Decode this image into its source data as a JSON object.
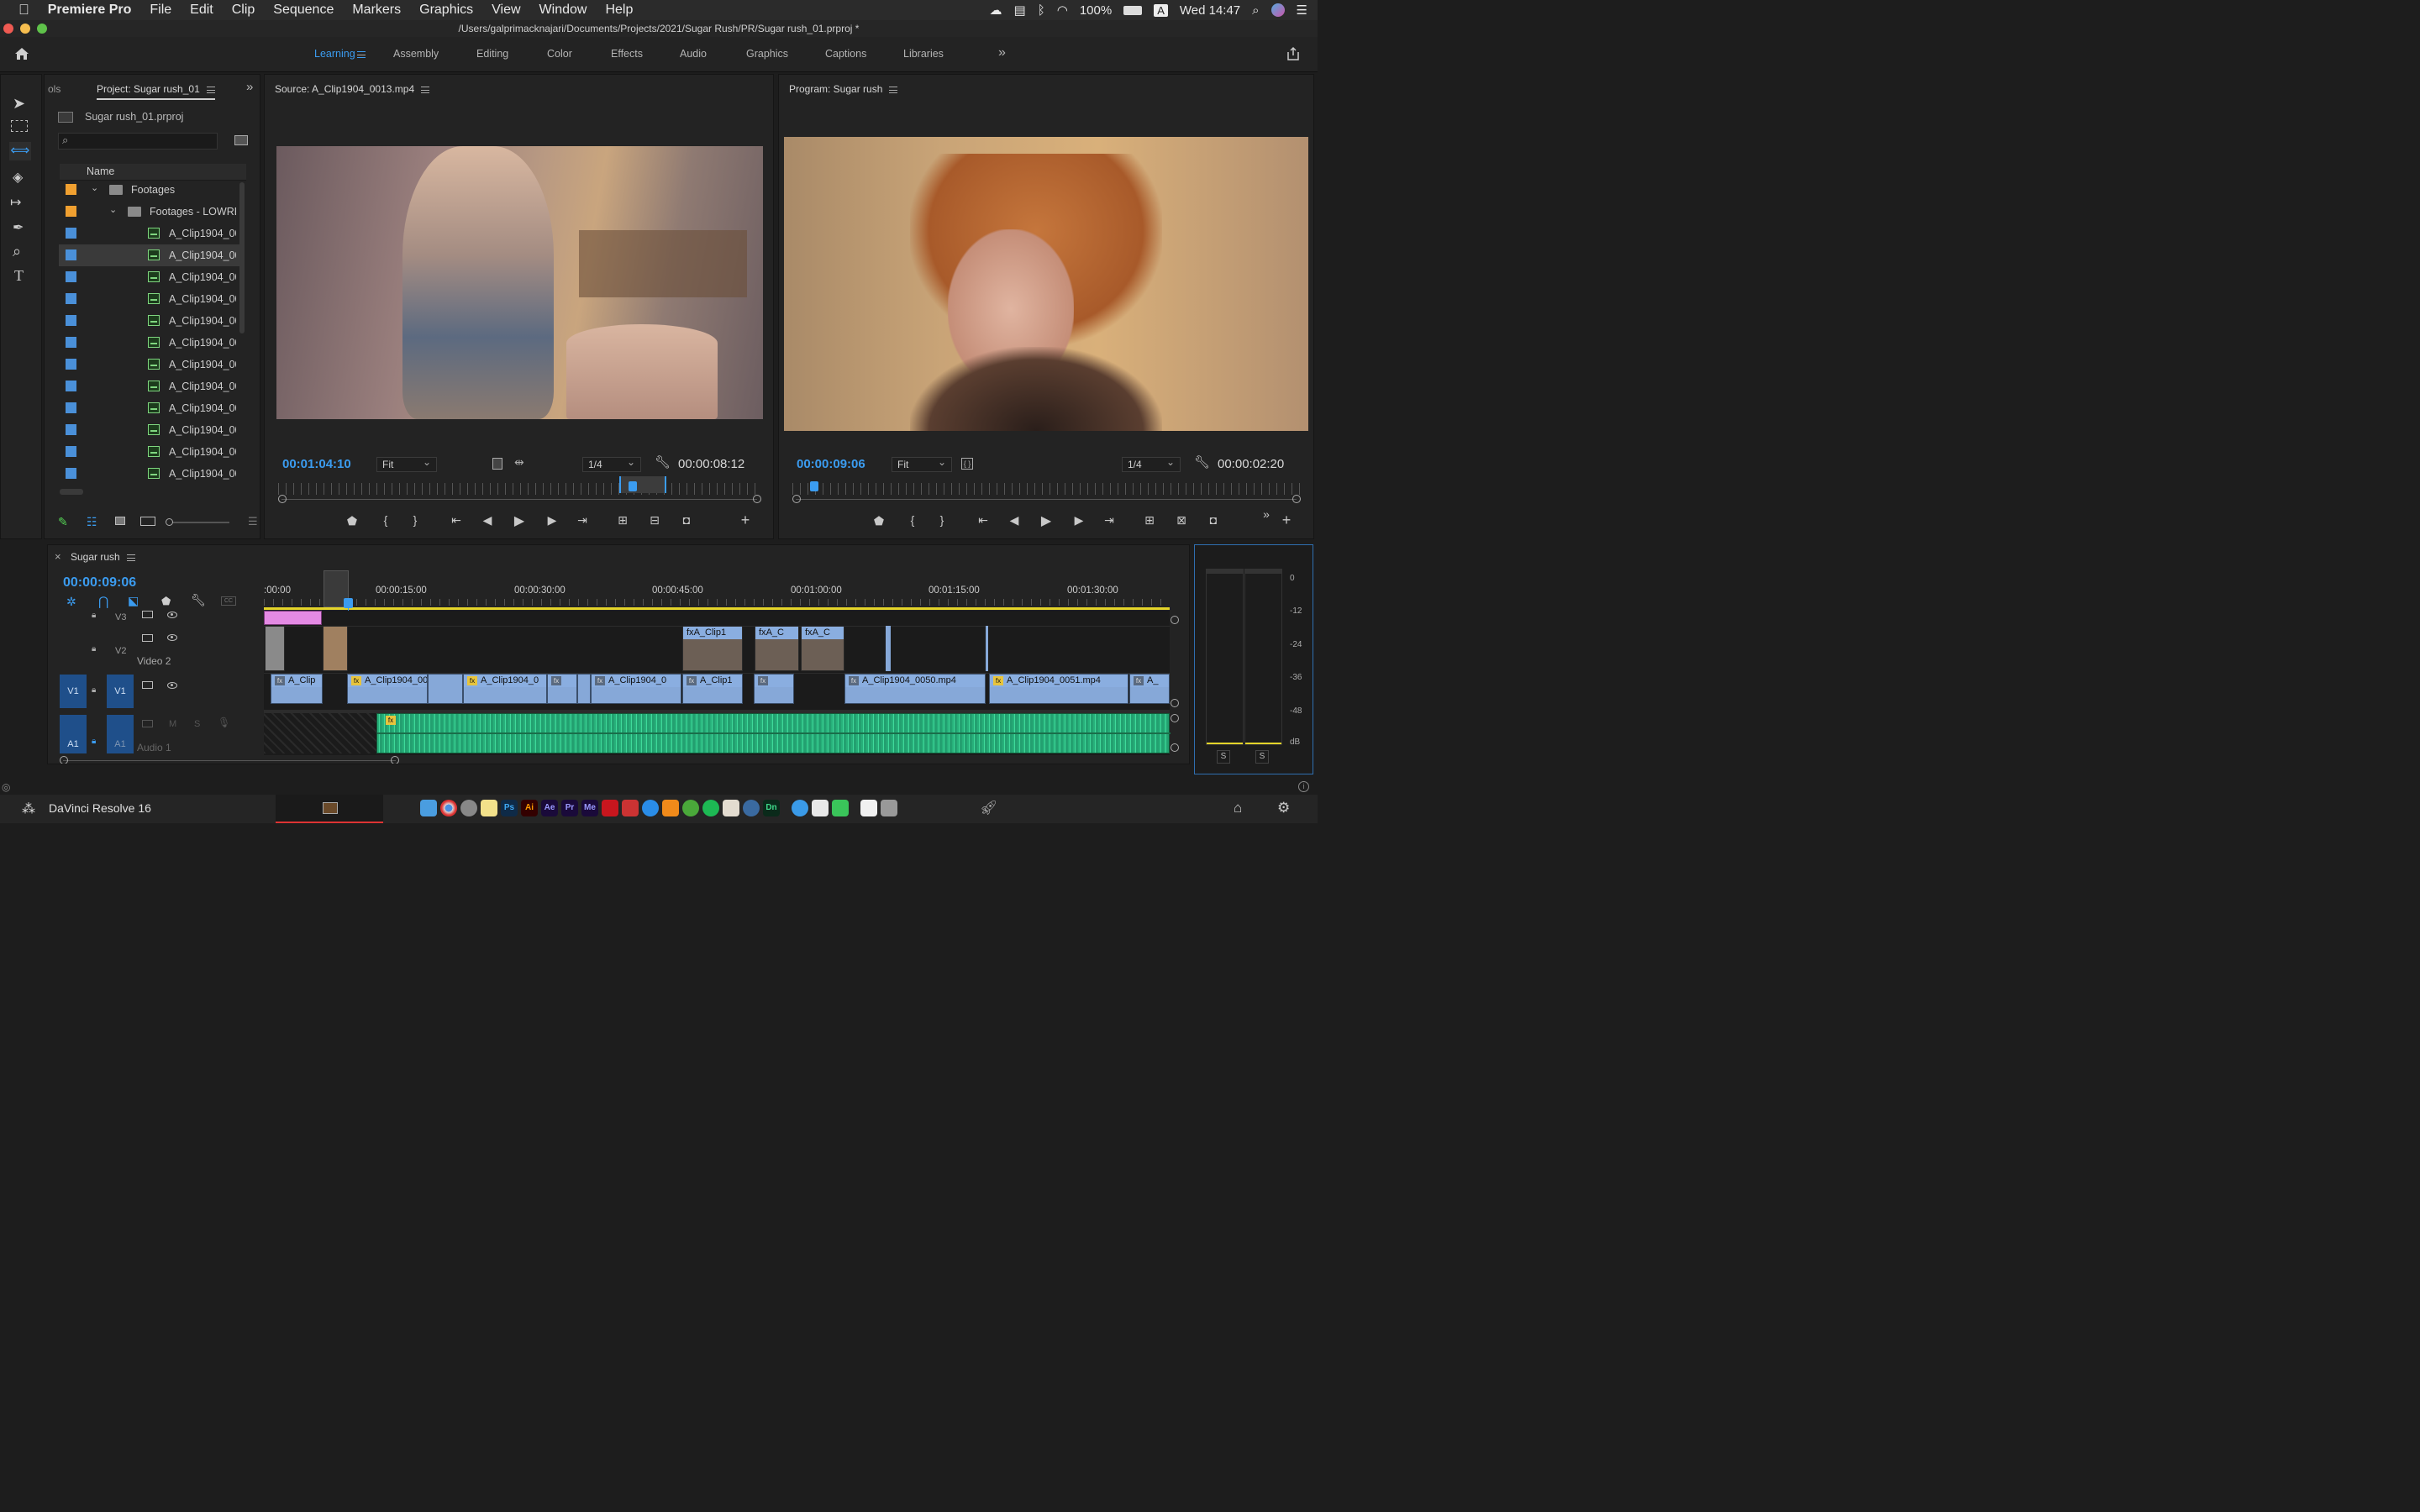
{
  "menubar": {
    "app": "Premiere Pro",
    "items": [
      "File",
      "Edit",
      "Clip",
      "Sequence",
      "Markers",
      "Graphics",
      "View",
      "Window",
      "Help"
    ],
    "battery": "100%",
    "input_source": "A",
    "clock": "Wed 14:47"
  },
  "window": {
    "title": "/Users/galprimacknajari/Documents/Projects/2021/Sugar Rush/PR/Sugar rush_01.prproj *"
  },
  "workspaces": {
    "items": [
      "Learning",
      "Assembly",
      "Editing",
      "Color",
      "Effects",
      "Audio",
      "Graphics",
      "Captions",
      "Libraries"
    ],
    "active": "Learning",
    "more": "»"
  },
  "project_panel": {
    "tab_truncated": "ols",
    "title": "Project: Sugar rush_01",
    "more": "»",
    "file": "Sugar rush_01.prproj",
    "column_name": "Name",
    "bins": [
      {
        "label": "Footages",
        "color": "#f0a030"
      },
      {
        "label": "Footages - LOWRES",
        "color": "#f0a030"
      }
    ],
    "clips": [
      "A_Clip1904_00",
      "A_Clip1904_00",
      "A_Clip1904_00",
      "A_Clip1904_00",
      "A_Clip1904_00",
      "A_Clip1904_00",
      "A_Clip1904_00",
      "A_Clip1904_00",
      "A_Clip1904_00",
      "A_Clip1904_00",
      "A_Clip1904_00",
      "A_Clip1904_00"
    ],
    "clip_color": "#4a90d9"
  },
  "source_monitor": {
    "title": "Source: A_Clip1904_0013.mp4",
    "timecode": "00:01:04:10",
    "fit": "Fit",
    "resolution": "1/4",
    "duration": "00:00:08:12"
  },
  "program_monitor": {
    "title": "Program: Sugar rush",
    "timecode": "00:00:09:06",
    "fit": "Fit",
    "resolution": "1/4",
    "duration": "00:00:02:20"
  },
  "timeline": {
    "close": "×",
    "title": "Sugar rush",
    "timecode": "00:00:09:06",
    "ruler": [
      ":00:00",
      "00:00:15:00",
      "00:00:30:00",
      "00:00:45:00",
      "00:01:00:00",
      "00:01:15:00",
      "00:01:30:00"
    ],
    "tracks": {
      "v3": "V3",
      "v2": "V2",
      "v2_name": "Video 2",
      "v1": "V1",
      "v1_src": "V1",
      "a1": "A1",
      "a1_src": "A1",
      "a1_name": "Audio 1",
      "a1_m": "M",
      "a1_s": "S"
    },
    "v1_clips": [
      "A_Clip",
      "A_Clip1904_00",
      "A_Clip1904_0",
      "A_Clip1904_0",
      "A_Clip1",
      "A_Clip1904_0050.mp4",
      "A_Clip1904_0051.mp4",
      "A_"
    ],
    "v2_clips": [
      "A_Clip1",
      "A_C",
      "A_C"
    ],
    "fx_label": "fx"
  },
  "audio_meter": {
    "scale": [
      "0",
      "-12",
      "-24",
      "-36",
      "-48",
      "dB"
    ],
    "solo_left": "S",
    "solo_right": "S"
  },
  "dock": {
    "app_label": "DaVinci Resolve 16",
    "apps": [
      "Ps",
      "Ai",
      "Ae",
      "Pr",
      "Me",
      "Dn"
    ]
  }
}
